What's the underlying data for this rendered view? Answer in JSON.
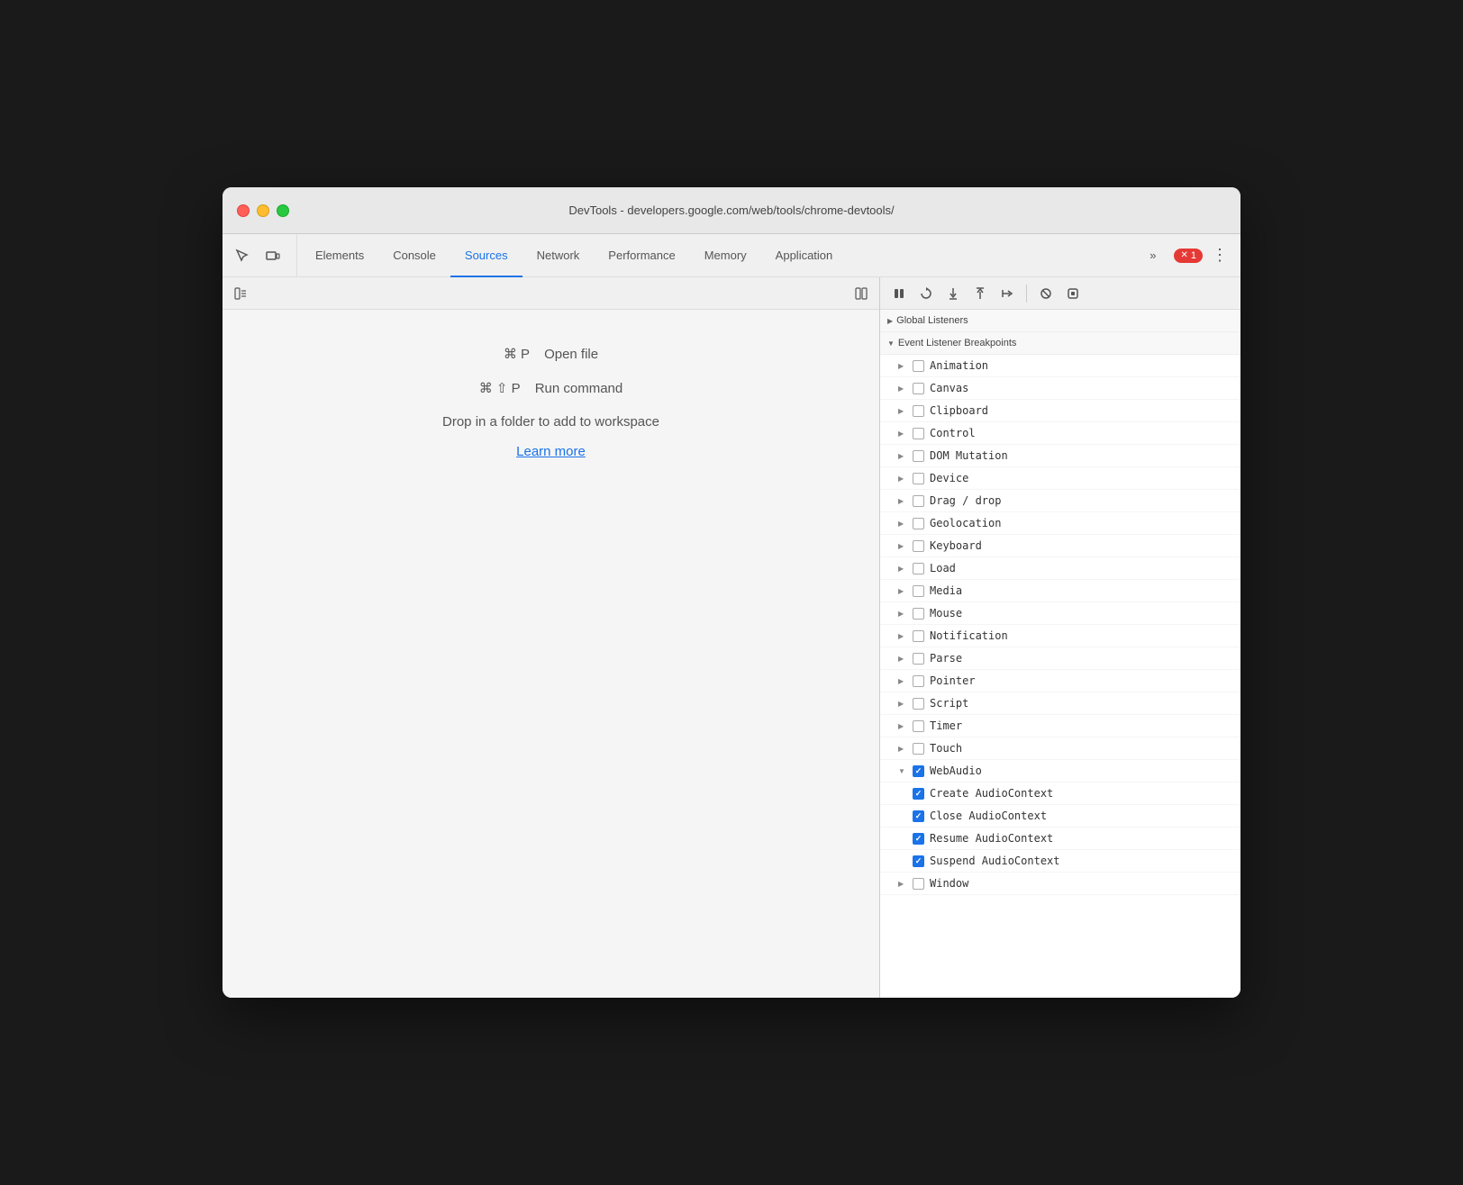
{
  "window": {
    "title": "DevTools - developers.google.com/web/tools/chrome-devtools/"
  },
  "tabs": {
    "items": [
      {
        "id": "elements",
        "label": "Elements",
        "active": false
      },
      {
        "id": "console",
        "label": "Console",
        "active": false
      },
      {
        "id": "sources",
        "label": "Sources",
        "active": true
      },
      {
        "id": "network",
        "label": "Network",
        "active": false
      },
      {
        "id": "performance",
        "label": "Performance",
        "active": false
      },
      {
        "id": "memory",
        "label": "Memory",
        "active": false
      },
      {
        "id": "application",
        "label": "Application",
        "active": false
      }
    ],
    "more_label": "»",
    "error_count": "1"
  },
  "sources": {
    "shortcut1_key": "⌘ P",
    "shortcut1_label": "Open file",
    "shortcut2_key": "⌘ ⇧ P",
    "shortcut2_label": "Run command",
    "drop_text": "Drop in a folder to add to workspace",
    "learn_more": "Learn more"
  },
  "breakpoints": {
    "section_label": "Event Listener Breakpoints",
    "items": [
      {
        "id": "animation",
        "label": "Animation",
        "checked": false,
        "expanded": false
      },
      {
        "id": "canvas",
        "label": "Canvas",
        "checked": false,
        "expanded": false
      },
      {
        "id": "clipboard",
        "label": "Clipboard",
        "checked": false,
        "expanded": false
      },
      {
        "id": "control",
        "label": "Control",
        "checked": false,
        "expanded": false
      },
      {
        "id": "dom-mutation",
        "label": "DOM Mutation",
        "checked": false,
        "expanded": false
      },
      {
        "id": "device",
        "label": "Device",
        "checked": false,
        "expanded": false
      },
      {
        "id": "drag-drop",
        "label": "Drag / drop",
        "checked": false,
        "expanded": false
      },
      {
        "id": "geolocation",
        "label": "Geolocation",
        "checked": false,
        "expanded": false
      },
      {
        "id": "keyboard",
        "label": "Keyboard",
        "checked": false,
        "expanded": false
      },
      {
        "id": "load",
        "label": "Load",
        "checked": false,
        "expanded": false
      },
      {
        "id": "media",
        "label": "Media",
        "checked": false,
        "expanded": false
      },
      {
        "id": "mouse",
        "label": "Mouse",
        "checked": false,
        "expanded": false
      },
      {
        "id": "notification",
        "label": "Notification",
        "checked": false,
        "expanded": false
      },
      {
        "id": "parse",
        "label": "Parse",
        "checked": false,
        "expanded": false
      },
      {
        "id": "pointer",
        "label": "Pointer",
        "checked": false,
        "expanded": false
      },
      {
        "id": "script",
        "label": "Script",
        "checked": false,
        "expanded": false
      },
      {
        "id": "timer",
        "label": "Timer",
        "checked": false,
        "expanded": false
      },
      {
        "id": "touch",
        "label": "Touch",
        "checked": false,
        "expanded": false
      },
      {
        "id": "webaudio",
        "label": "WebAudio",
        "checked": true,
        "expanded": true
      }
    ],
    "webaudio_sub": [
      {
        "id": "create-audio",
        "label": "Create AudioContext",
        "checked": true
      },
      {
        "id": "close-audio",
        "label": "Close AudioContext",
        "checked": true
      },
      {
        "id": "resume-audio",
        "label": "Resume AudioContext",
        "checked": true
      },
      {
        "id": "suspend-audio",
        "label": "Suspend AudioContext",
        "checked": true
      }
    ],
    "window_item": {
      "id": "window",
      "label": "Window",
      "checked": false,
      "expanded": false
    }
  },
  "global_listeners_label": "Global Listeners",
  "icons": {
    "cursor": "⬜",
    "device": "▭",
    "pause": "⏸",
    "step_over": "↷",
    "step_into": "↓",
    "step_out": "↑",
    "step": "→",
    "deactivate": "⚡",
    "stop": "⏸"
  }
}
